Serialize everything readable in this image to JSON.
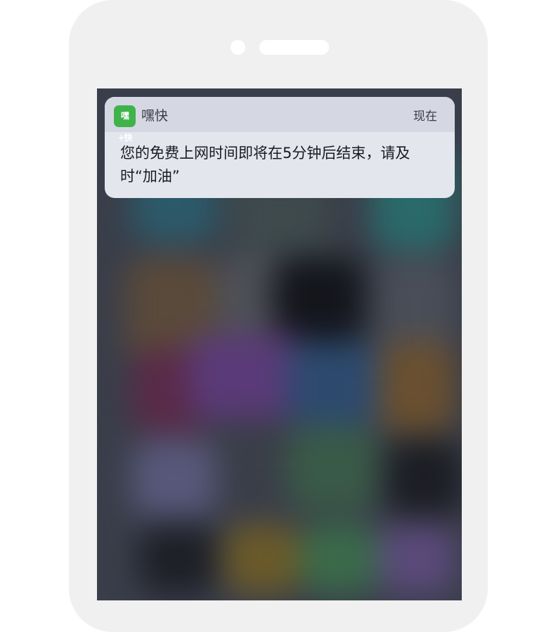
{
  "device": {
    "type": "smartphone mockup",
    "frame_color": "#f0f0f0"
  },
  "notification": {
    "app_icon": {
      "name": "app-icon",
      "glyph": "嘿+快",
      "color": "#3fb34a"
    },
    "app_name": "嘿快",
    "time": "现在",
    "message": "您的免费上网时间即将在5分钟后结束，请及时“加油”"
  },
  "colors": {
    "notification_bg": "#e4e6ee",
    "notification_header_bg": "#d5d8e2",
    "screen_bg": "#3a3e4a"
  }
}
